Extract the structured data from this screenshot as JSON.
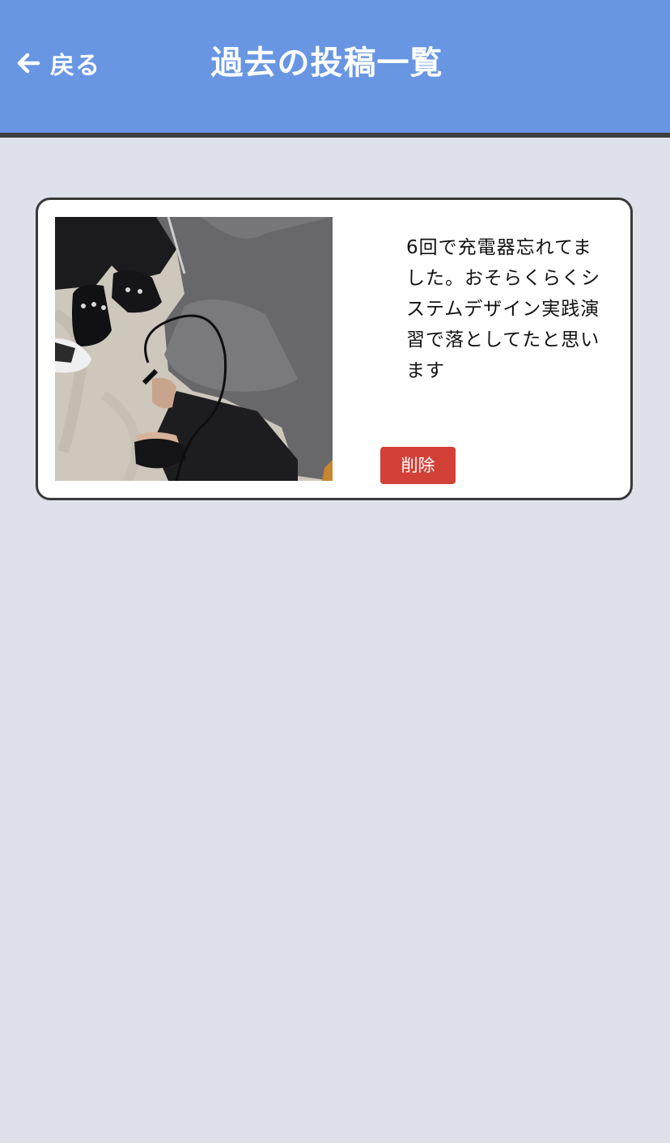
{
  "header": {
    "back_label": "戻る",
    "back_icon": "arrow-left-icon",
    "title": "過去の投稿一覧",
    "background_color": "#6896e2"
  },
  "posts": [
    {
      "text": "6回で充電器忘れてました。おそらくらくシステムデザイン実践演習で落としてたと思います",
      "delete_label": "削除",
      "delete_color": "#d24037"
    }
  ]
}
